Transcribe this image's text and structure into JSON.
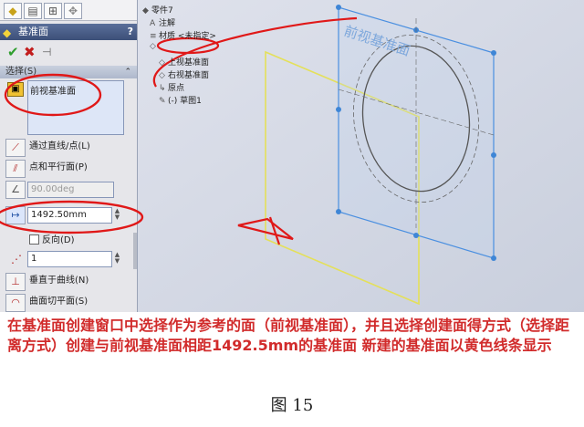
{
  "property_manager": {
    "tabs": [
      "feature-manager-tab",
      "property-manager-tab",
      "configuration-tab",
      "display-tab"
    ],
    "title": "基准面",
    "help": "?",
    "section_label": "选择(S)",
    "reference": "前视基准面",
    "options": [
      {
        "label": "通过直线/点(L)"
      },
      {
        "label": "点和平行面(P)"
      }
    ],
    "angle_value": "90.00deg",
    "distance_value": "1492.50mm",
    "reverse_label": "反向(D)",
    "count_value": "1",
    "more_options": [
      {
        "label": "垂直于曲线(N)"
      },
      {
        "label": "曲面切平面(S)"
      }
    ]
  },
  "feature_tree": {
    "root": "零件7",
    "items": [
      "注解",
      "材质 <未指定>",
      "",
      "上视基准面",
      "右视基准面",
      "原点",
      "(-) 草图1"
    ]
  },
  "viewport": {
    "plane_label": "前视基准面"
  },
  "caption": "在基准面创建窗口中选择作为参考的面（前视基准面），并且选择创建面得方式（选择距离方式）创建与前视基准面相距1492.5mm的基准面 新建的基准面以黄色线条显示",
  "figure_label": "图 15",
  "colors": {
    "annotation": "#e01818",
    "plane_blue": "#2f7fd6",
    "new_plane": "#e4e05a"
  }
}
